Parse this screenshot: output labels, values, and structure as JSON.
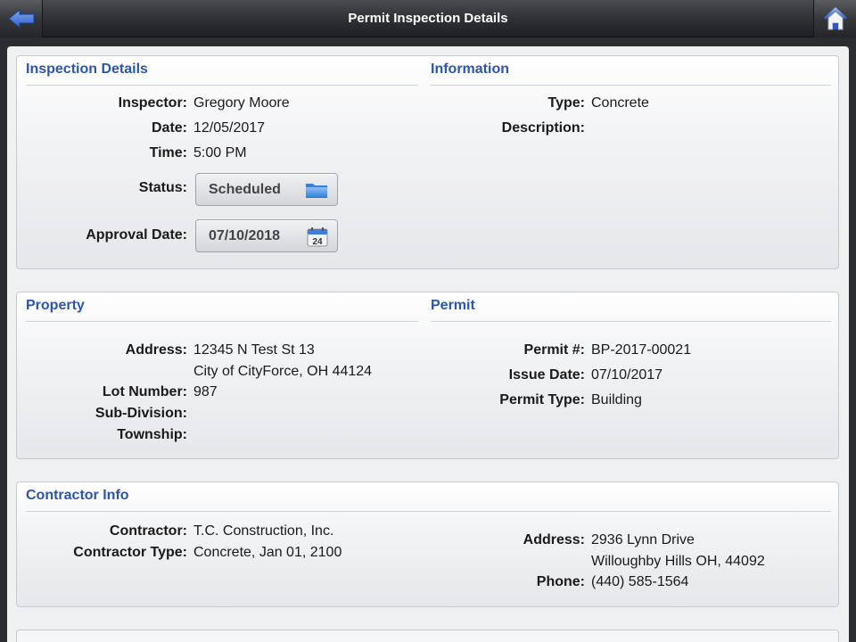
{
  "header": {
    "title": "Permit Inspection Details"
  },
  "inspection": {
    "heading": "Inspection Details",
    "inspector_label": "Inspector:",
    "inspector": "Gregory Moore",
    "date_label": "Date:",
    "date": "12/05/2017",
    "time_label": "Time:",
    "time": "5:00 PM",
    "status_label": "Status:",
    "status": "Scheduled",
    "approval_label": "Approval Date:",
    "approval_date": "07/10/2018",
    "calendar_day": "24"
  },
  "information": {
    "heading": "Information",
    "type_label": "Type:",
    "type": "Concrete",
    "description_label": "Description:",
    "description": ""
  },
  "property": {
    "heading": "Property",
    "address_label": "Address:",
    "address_line1": "12345 N Test St 13",
    "address_line2": "City of CityForce, OH 44124",
    "lot_label": "Lot Number:",
    "lot": "987",
    "subdivision_label": "Sub-Division:",
    "subdivision": "",
    "township_label": "Township:",
    "township": ""
  },
  "permit": {
    "heading": "Permit",
    "number_label": "Permit #:",
    "number": "BP-2017-00021",
    "issue_label": "Issue Date:",
    "issue_date": "07/10/2017",
    "type_label": "Permit Type:",
    "type": "Building"
  },
  "contractor": {
    "heading": "Contractor Info",
    "contractor_label": "Contractor:",
    "contractor": "T.C. Construction, Inc.",
    "type_label": "Contractor Type:",
    "type": "Concrete, Jan 01, 2100",
    "address_label": "Address:",
    "address_line1": "2936 Lynn Drive",
    "address_line2": "Willoughby Hills OH, 44092",
    "phone_label": "Phone:",
    "phone": "(440) 585-1564"
  },
  "colors": {
    "accent": "#2f56a6",
    "back_arrow": "#3b6fd8"
  },
  "icons": {
    "back": "back-arrow-icon",
    "home": "home-icon",
    "folder": "folder-icon",
    "calendar": "calendar-icon"
  }
}
